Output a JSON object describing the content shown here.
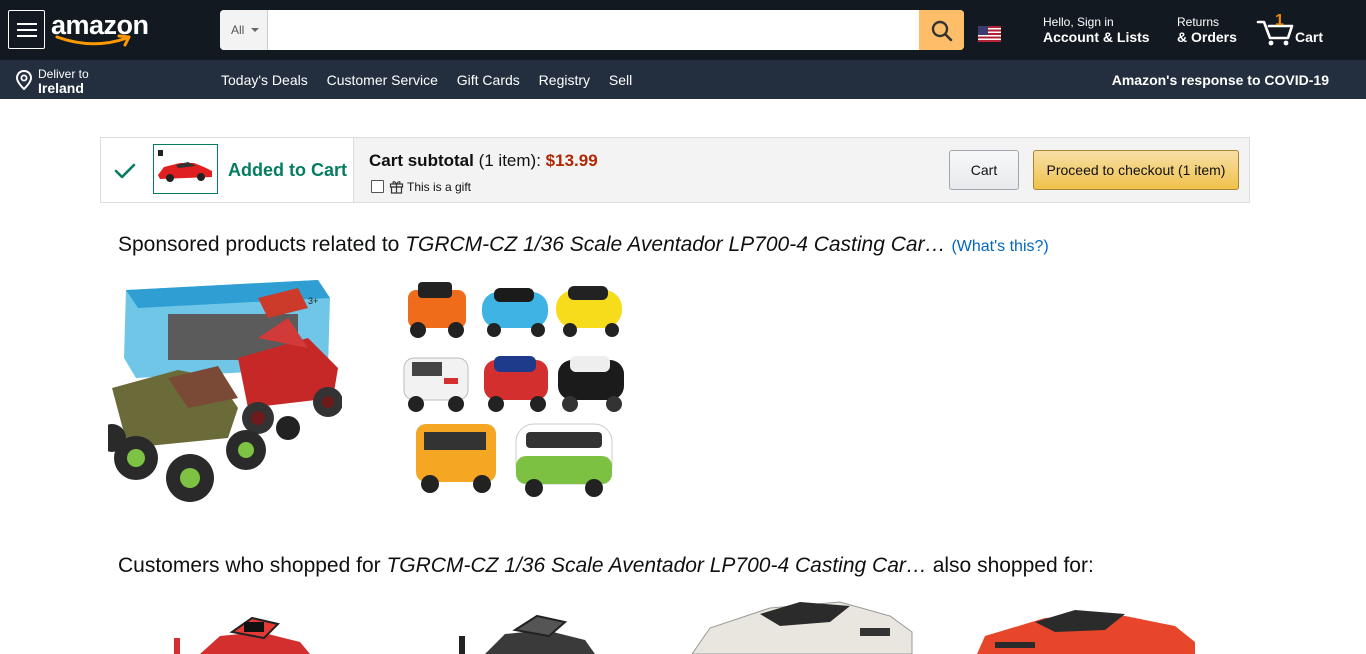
{
  "header": {
    "logo_text": "amazon",
    "search": {
      "department": "All",
      "placeholder": "",
      "value": ""
    },
    "account": {
      "line1": "Hello, Sign in",
      "line2": "Account & Lists"
    },
    "returns": {
      "line1": "Returns",
      "line2": "& Orders"
    },
    "cart": {
      "count": "1",
      "label": "Cart"
    }
  },
  "subnav": {
    "deliver": {
      "line1": "Deliver to",
      "line2": "Ireland"
    },
    "links": [
      "Today's Deals",
      "Customer Service",
      "Gift Cards",
      "Registry",
      "Sell"
    ],
    "covid": "Amazon's response to COVID-19"
  },
  "added_to_cart": {
    "title": "Added to Cart",
    "subtotal_label": "Cart subtotal",
    "item_count": "(1 item):",
    "price": "$13.99",
    "gift_label": "This is a gift",
    "cart_button": "Cart",
    "checkout_button": "Proceed to checkout (1 item)"
  },
  "sponsored": {
    "prefix": "Sponsored products related to ",
    "product": "TGRCM-CZ 1/36 Scale Aventador LP700-4 Casting Car…",
    "whats_this": "(What's this?)"
  },
  "also_shopped": {
    "prefix": "Customers who shopped for ",
    "product": "TGRCM-CZ 1/36 Scale Aventador LP700-4 Casting Car…",
    "suffix": " also shopped for:"
  },
  "icons": {
    "menu": "hamburger-menu-icon",
    "search": "search-icon",
    "flag": "us-flag-icon",
    "cart": "cart-icon",
    "location": "location-pin-icon",
    "check": "checkmark-icon",
    "gift": "gift-icon"
  },
  "colors": {
    "nav_dark": "#131921",
    "nav_secondary": "#232f3e",
    "search_button": "#febd69",
    "success_green": "#067d62",
    "price_red": "#b12704",
    "link_blue": "#0066c0",
    "checkout_yellow": "#f0c14b"
  }
}
